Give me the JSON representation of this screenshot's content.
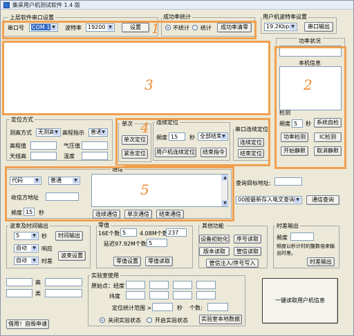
{
  "titlebar": {
    "title": "集采用户机测试软件 1.4 版"
  },
  "serial": {
    "legend": "上层软件串口设置",
    "port_label": "串口号",
    "port_value": "COM 1",
    "baud_label": "波特率",
    "baud_value": "19200",
    "set_button": "设置"
  },
  "success": {
    "legend": "成功率统计",
    "radio_nostat": "不统计",
    "radio_stat": "统计",
    "clear_button": "成功率清零"
  },
  "user_baud": {
    "legend": "用户机波特率设置",
    "value": "19.2Kbps",
    "output_button": "串口输出"
  },
  "power": {
    "title": "功率状况",
    "info_title": "本机信息"
  },
  "check": {
    "legend": "检测",
    "freq_label": "频度",
    "freq_value": "5",
    "sec": "秒",
    "self_check": "系统自检",
    "power_check": "功率检测",
    "ic_check": "IC检测",
    "start_silent": "开始静默",
    "cancel_silent": "取消静默"
  },
  "locate_mode": {
    "legend": "定位方式",
    "measure_label": "测高方式",
    "measure_value": "无测高",
    "altitude_label": "高程指示",
    "altitude_value": "普通",
    "elevation_label": "高程值",
    "pressure_label": "气压值",
    "antenna_label": "天线高",
    "temp_label": "温度"
  },
  "single": {
    "legend": "单次",
    "single_locate": "单次定位",
    "emergency_locate": "紧急定位"
  },
  "continuous": {
    "legend": "连续定位",
    "freq_label": "频度",
    "freq_value": "15",
    "sec": "秒",
    "all_end": "全部结束",
    "user_continuous": "用户机连续定位",
    "end_command": "结束指令"
  },
  "serial_cont": {
    "legend": "串口连续定位",
    "continuous_locate": "连续定位",
    "end_locate": "结束定位"
  },
  "comm": {
    "legend": "通信",
    "code_value": "代码",
    "normal_value": "普通",
    "recv_label": "收信方地址",
    "freq_label": "频度",
    "freq_value": "15",
    "sec": "秒",
    "continuous_comm": "连续通信",
    "single_comm": "单次通信",
    "end_comm": "结束通信"
  },
  "query": {
    "address_label": "查询目标地址:",
    "mode_value": "00按最新存入电文查询",
    "query_button": "通信查询"
  },
  "wave": {
    "legend": "波束及时间输出",
    "sec_value": "5",
    "sec": "秒",
    "time_out": "时间输出",
    "auto1": "自动",
    "response": "响应",
    "auto2": "自动",
    "timer": "时差",
    "wave_set": "波束设置"
  },
  "zero": {
    "legend": "零值",
    "num16_label": "16E个数",
    "num16_value": "5",
    "num408_label": "4.08M个数",
    "num408_value": "237",
    "delay_label": "延迟97.92M个数",
    "delay_value": "5",
    "zero_set": "零值设置",
    "zero_read": "零值读取"
  },
  "other": {
    "legend": "其他功能",
    "init": "设备初始化",
    "serial_read": "序号读取",
    "version_read": "版本读取",
    "manage_read": "管信读取",
    "manage_write": "管信注入/序号写入"
  },
  "timediff": {
    "legend": "时差输出",
    "freq_label": "频度",
    "note": "频度以秒计时的整数倍来输出时差。",
    "output": "时差输出"
  },
  "coords": {
    "high_label": "高",
    "type_label": "类"
  },
  "lab": {
    "legend": "实验室使用",
    "origin_label": "原始点：经度",
    "lat_label": "纬度",
    "range_label": "定位统计范围 >",
    "sec": "秒",
    "count_label": "个数:",
    "close_lab": "关闭实验状态",
    "open_lab": "开启实验状态",
    "lab_stat": "实验室本地数据"
  },
  "read_info": "一键读取用户机信息",
  "apply": "借用！自毁申请",
  "annotations": [
    "1",
    "2",
    "3",
    "4",
    "5"
  ],
  "colors": {
    "highlight": "#f0a050",
    "annotation": "#f08a30"
  }
}
